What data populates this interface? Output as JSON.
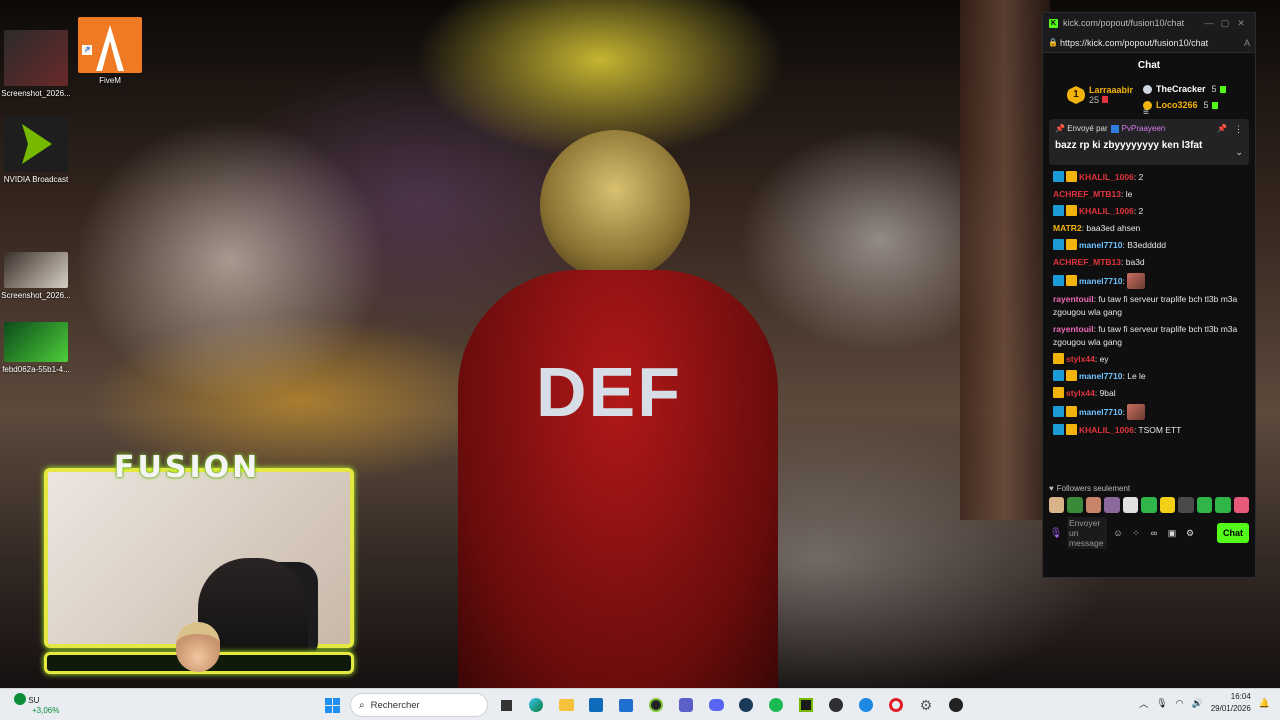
{
  "desktop": {
    "icons": [
      {
        "label": "Screenshot_2026...",
        "icon": "screenshot-thumbnail"
      },
      {
        "label": "FiveM",
        "icon": "fivem-logo"
      },
      {
        "label": "NVIDIA Broadcast",
        "icon": "nvidia-broadcast-logo"
      },
      {
        "label": "Screenshot_2026...",
        "icon": "screenshot-thumbnail"
      },
      {
        "label": "febd062a-55b1-4...",
        "icon": "image-thumbnail"
      }
    ]
  },
  "game": {
    "shirt_text": "DEF"
  },
  "overlay": {
    "logo": "FUSION"
  },
  "browser": {
    "tab_title": "kick.com/popout/fusion10/chat",
    "url": "https://kick.com/popout/fusion10/chat",
    "window_controls": [
      "—",
      "▢",
      "✕"
    ]
  },
  "chat": {
    "header": "Chat",
    "leaderboard": {
      "first": {
        "rank": "1",
        "name": "Larraaabir",
        "count": "25"
      },
      "others": [
        {
          "name": "TheCracker",
          "count": "5",
          "color": "#ffffff"
        },
        {
          "name": "Loco3266",
          "count": "5",
          "color": "#f2b30c"
        }
      ]
    },
    "pinned": {
      "sent_by_label": "Envoyé par",
      "sender": "PvPraayeen",
      "message": "bazz rp ki zbyyyyyyyy ken l3fat"
    },
    "messages": [
      {
        "user": "KHALIL_1006",
        "color": "#e0343c",
        "badges": [
          "blue",
          "crown"
        ],
        "text": "2",
        "emote": false
      },
      {
        "user": "ACHREF_MTB13",
        "color": "#e0343c",
        "badges": [],
        "text": "le",
        "emote": false
      },
      {
        "user": "KHALIL_1006",
        "color": "#e0343c",
        "badges": [
          "blue",
          "crown"
        ],
        "text": "2",
        "emote": false
      },
      {
        "user": "MATR2",
        "color": "#f2b30c",
        "badges": [],
        "text": "baa3ed ahsen",
        "emote": false
      },
      {
        "user": "manel7710",
        "color": "#6fc3ff",
        "badges": [
          "blue",
          "crown"
        ],
        "text": "B3eddddd",
        "emote": false
      },
      {
        "user": "ACHREF_MTB13",
        "color": "#e0343c",
        "badges": [],
        "text": "ba3d",
        "emote": false
      },
      {
        "user": "manel7710",
        "color": "#6fc3ff",
        "badges": [
          "blue",
          "crown"
        ],
        "text": "",
        "emote": true
      },
      {
        "user": "rayentouil",
        "color": "#f06bb8",
        "badges": [],
        "text": "fu taw fi serveur traplife bch tl3b m3a zgougou wla gang",
        "emote": false
      },
      {
        "user": "rayentouil",
        "color": "#f06bb8",
        "badges": [],
        "text": "fu taw fi serveur traplife bch tl3b m3a zgougou wla gang",
        "emote": false
      },
      {
        "user": "stylx44",
        "color": "#e0343c",
        "badges": [
          "crown"
        ],
        "text": "ey",
        "emote": false
      },
      {
        "user": "manel7710",
        "color": "#6fc3ff",
        "badges": [
          "blue",
          "crown"
        ],
        "text": "Le le",
        "emote": false
      },
      {
        "user": "stylx44",
        "color": "#e0343c",
        "badges": [
          "crown"
        ],
        "text": "9bal",
        "emote": false
      },
      {
        "user": "manel7710",
        "color": "#6fc3ff",
        "badges": [
          "blue",
          "crown"
        ],
        "text": "",
        "emote": true
      },
      {
        "user": "KHALIL_1006",
        "color": "#e0343c",
        "badges": [
          "blue",
          "crown"
        ],
        "text": "TSOM ETT",
        "emote": false
      }
    ],
    "followers_only": "Followers seulement",
    "composer": {
      "placeholder": "Envoyer un message",
      "send_label": "Chat"
    },
    "accent": "#53fc18"
  },
  "taskbar": {
    "weather": {
      "label": "SU",
      "change": "+3,06%"
    },
    "search_placeholder": "Rechercher",
    "time": "16:04",
    "date": "29/01/2026",
    "pinned_apps": [
      "task-view",
      "edge",
      "file-explorer",
      "outlook",
      "microsoft-store",
      "xbox",
      "teams",
      "discord",
      "steam",
      "spotify",
      "nvidia",
      "obs",
      "vpn",
      "opera",
      "settings",
      "media-player"
    ]
  }
}
